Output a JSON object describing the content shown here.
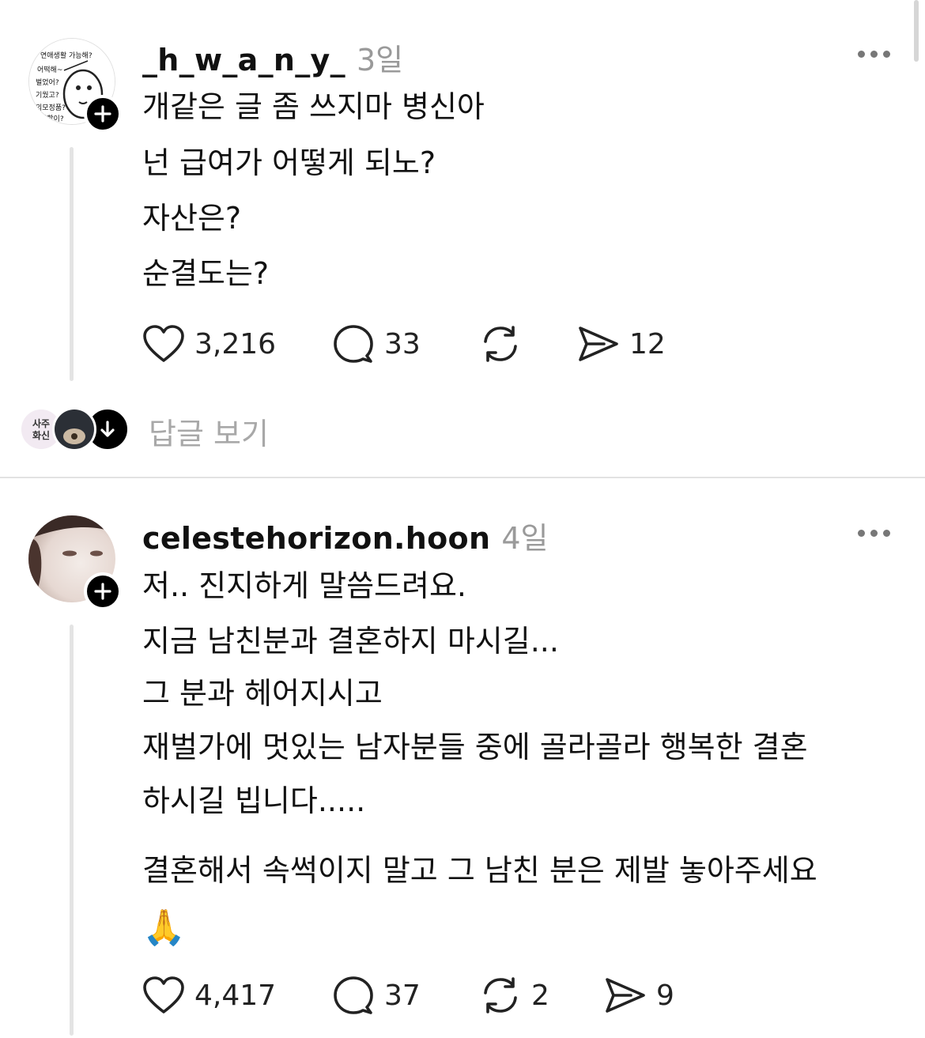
{
  "posts": [
    {
      "username": "_h_w_a_n_y_",
      "time": "3일",
      "lines": [
        "개같은 글 좀 쓰지마 병신아",
        "넌 급여가 어떻게 되노?",
        "자산은?",
        "순결도는?"
      ],
      "likes": "3,216",
      "comments": "33",
      "reposts": "",
      "shares": "12"
    },
    {
      "username": "celestehorizon.hoon",
      "time": "4일",
      "lines": [
        "저.. 진지하게 말씀드려요.",
        "지금 남친분과 결혼하지 마시길...",
        "그 분과 헤어지시고",
        "재벌가에 멋있는 남자분들 중에 골라골라 행복한 결혼",
        "하시길 빕니다.....",
        "결혼해서 속썩이지 말고 그 남친 분은 제발 놓아주세요",
        "🙏"
      ],
      "likes": "4,417",
      "comments": "37",
      "reposts": "2",
      "shares": "9"
    }
  ],
  "replies": {
    "label": "답글 보기",
    "mini_avatar_text": "사주\n화신"
  },
  "avatar1_text": [
    "연애생활 가능해?",
    "어떡해~",
    "벌었어?",
    "기웠고?",
    "외모정품?",
    "친할이?"
  ],
  "colors": {
    "muted": "#9a9a9a",
    "thread_line": "#e4e4e4"
  },
  "icons": [
    "heart-icon",
    "comment-icon",
    "repost-icon",
    "share-icon",
    "more-icon",
    "plus-icon",
    "arrow-down-icon"
  ]
}
